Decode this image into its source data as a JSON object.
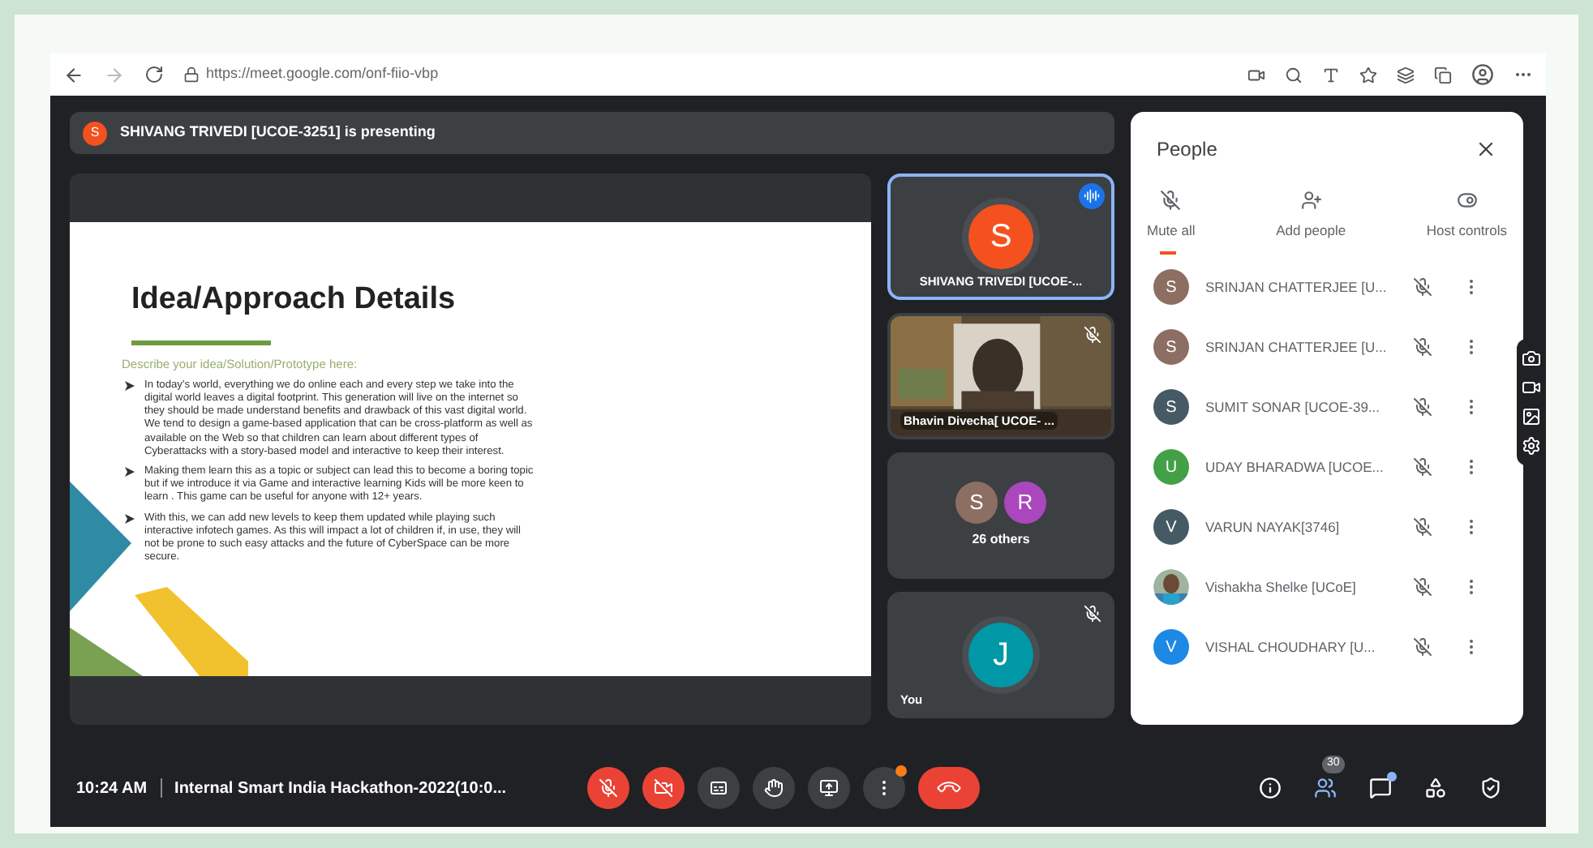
{
  "browser": {
    "url": "https://meet.google.com/onf-fiio-vbp"
  },
  "banner": {
    "avatar": "S",
    "text": "SHIVANG TRIVEDI [UCOE-3251] is presenting"
  },
  "slide": {
    "title": "Idea/Approach Details",
    "subtitle": "Describe your idea/Solution/Prototype here:",
    "bullets": [
      "In today's world, everything we do online each and every step we take into the digital world leaves a digital footprint. This generation will live on the internet so they should be made understand benefits and drawback of this vast digital world. We tend to design a game-based application that can be cross-platform as well as available on the Web so that children can learn about different types of Cyberattacks with a story-based model and interactive to keep their interest.",
      "Making them learn this as a topic or subject can lead this to become a boring topic but if we introduce it via Game and interactive learning Kids will be more keen to learn . This game can be useful for anyone with 12+ years.",
      "With this, we can add new levels to keep them updated while playing such interactive infotech games. As this will impact a lot of children if, in use, they will not be prone to such easy attacks and the future of CyberSpace can be more secure."
    ]
  },
  "tiles": [
    {
      "kind": "avatar",
      "letter": "S",
      "color": "#f4511e",
      "name": "SHIVANG TRIVEDI [UCOE-...",
      "selected": true,
      "speaking": true,
      "muted": false
    },
    {
      "kind": "video",
      "name": "Bhavin Divecha[ UCOE- ...",
      "selected": false,
      "speaking": false,
      "muted": true
    },
    {
      "kind": "group",
      "avatars": [
        {
          "letter": "S",
          "color": "#8d6e63"
        },
        {
          "letter": "R",
          "color": "#ab47bc"
        }
      ],
      "name": "26 others",
      "selected": false,
      "speaking": false,
      "muted": false
    },
    {
      "kind": "avatar",
      "letter": "J",
      "color": "#0097a7",
      "name": "You",
      "selected": false,
      "speaking": false,
      "muted": true
    }
  ],
  "people": {
    "title": "People",
    "actions": [
      {
        "kind": "mute",
        "label": "Mute all"
      },
      {
        "kind": "add",
        "label": "Add people"
      },
      {
        "kind": "host",
        "label": "Host controls"
      }
    ],
    "participants": [
      {
        "kind": "letter",
        "letter": "S",
        "color": "#8d6e63",
        "name": "SRINJAN CHATTERJEE [U..."
      },
      {
        "kind": "letter",
        "letter": "S",
        "color": "#8d6e63",
        "name": "SRINJAN CHATTERJEE [U..."
      },
      {
        "kind": "letter",
        "letter": "S",
        "color": "#455a64",
        "name": "SUMIT SONAR [UCOE-39..."
      },
      {
        "kind": "letter",
        "letter": "U",
        "color": "#43a047",
        "name": "UDAY BHARADWA [UCOE..."
      },
      {
        "kind": "letter",
        "letter": "V",
        "color": "#455a64",
        "name": "VARUN NAYAK[3746]"
      },
      {
        "name": "Vishakha Shelke [UCoE]"
      },
      {
        "kind": "letter",
        "letter": "V",
        "color": "#1e88e5",
        "name": "VISHAL CHOUDHARY [U..."
      }
    ]
  },
  "bottom_bar": {
    "time": "10:24 AM",
    "meeting": "Internal Smart India Hackathon-2022(10:0...",
    "controls": [
      {
        "kind": "mic",
        "off": true,
        "dot": false
      },
      {
        "kind": "camera",
        "off": true,
        "dot": false
      },
      {
        "kind": "captions",
        "off": false,
        "dot": false
      },
      {
        "kind": "hand",
        "off": false,
        "dot": false
      },
      {
        "kind": "present",
        "off": false,
        "dot": false
      },
      {
        "kind": "more",
        "off": false,
        "dot": true
      },
      {
        "kind": "end",
        "off": true,
        "dot": false
      }
    ],
    "right": [
      {
        "kind": "info",
        "dot": false
      },
      {
        "kind": "people",
        "badge": "30",
        "dot": false
      },
      {
        "kind": "chat",
        "dot": true
      },
      {
        "kind": "activities",
        "dot": false
      },
      {
        "kind": "safety",
        "dot": false
      }
    ]
  }
}
